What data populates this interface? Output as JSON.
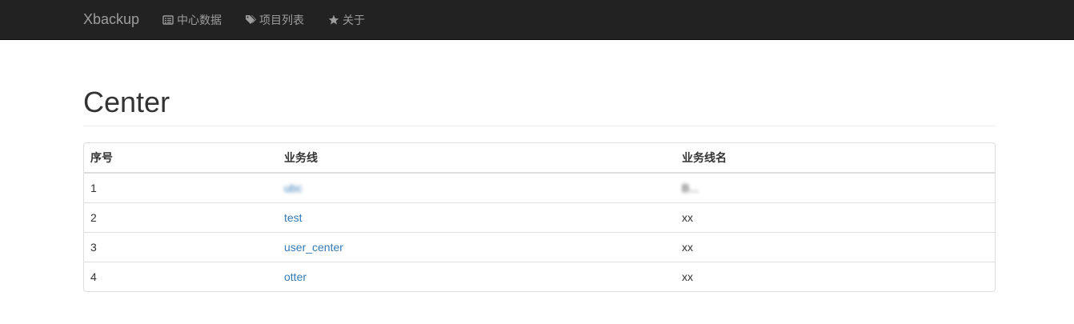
{
  "navbar": {
    "brand": "Xbackup",
    "items": [
      {
        "label": "中心数据",
        "icon": "list-alt-icon"
      },
      {
        "label": "项目列表",
        "icon": "tags-icon"
      },
      {
        "label": "关于",
        "icon": "star-icon"
      }
    ]
  },
  "page": {
    "title": "Center"
  },
  "table": {
    "headers": [
      "序号",
      "业务线",
      "业务线名"
    ],
    "rows": [
      {
        "index": "1",
        "business_line": "ubc",
        "business_name": "B..."
      },
      {
        "index": "2",
        "business_line": "test",
        "business_name": "xx"
      },
      {
        "index": "3",
        "business_line": "user_center",
        "business_name": "xx"
      },
      {
        "index": "4",
        "business_line": "otter",
        "business_name": "xx"
      }
    ]
  },
  "colors": {
    "navbar_bg": "#222222",
    "nav_text": "#9d9d9d",
    "link": "#337ab7"
  }
}
